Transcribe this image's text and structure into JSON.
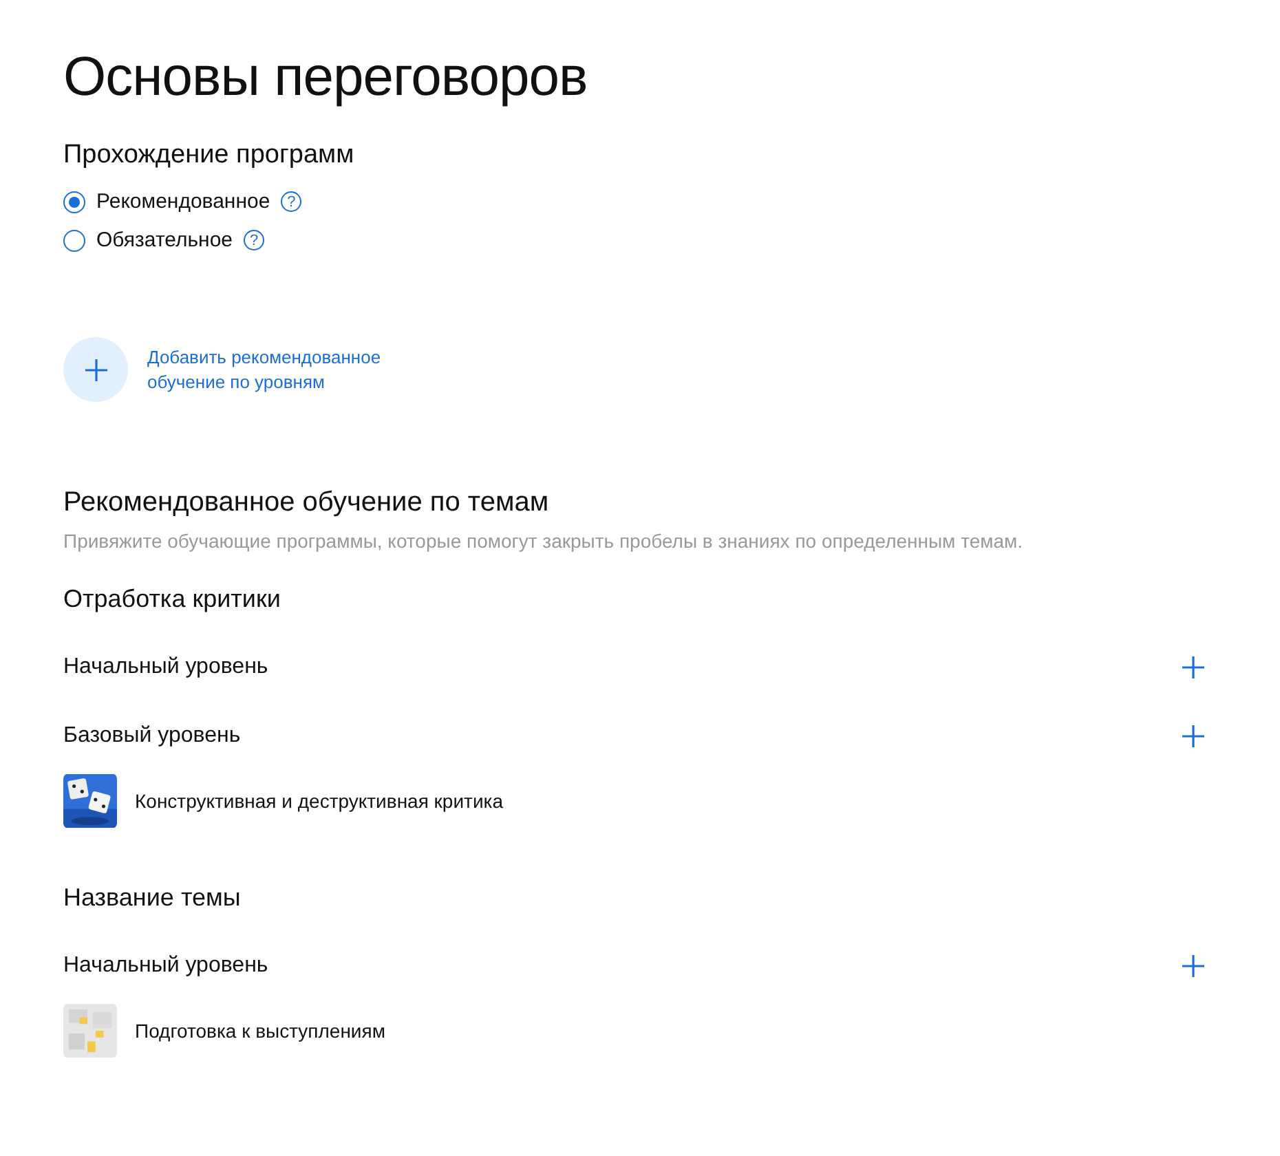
{
  "title": "Основы переговоров",
  "completion": {
    "heading": "Прохождение программ",
    "options": [
      {
        "label": "Рекомендованное",
        "selected": true,
        "help": "?"
      },
      {
        "label": "Обязательное",
        "selected": false,
        "help": "?"
      }
    ]
  },
  "add_levels": {
    "label": "Добавить рекомендованное обучение по уровням"
  },
  "topics_section": {
    "heading": "Рекомендованное обучение по темам",
    "description": "Привяжите обучающие программы, которые помогут закрыть пробелы в знаниях по определенным темам.",
    "topics": [
      {
        "name": "Отработка критики",
        "levels": [
          {
            "name": "Начальный уровень"
          },
          {
            "name": "Базовый уровень",
            "programs": [
              {
                "title": "Конструктивная и деструктивная критика",
                "kind": "picture"
              }
            ]
          }
        ]
      },
      {
        "name": "Название темы",
        "levels": [
          {
            "name": "Начальный уровень",
            "programs": [
              {
                "title": "Подготовка к выступлениям",
                "kind": "picture"
              }
            ]
          }
        ]
      }
    ]
  }
}
